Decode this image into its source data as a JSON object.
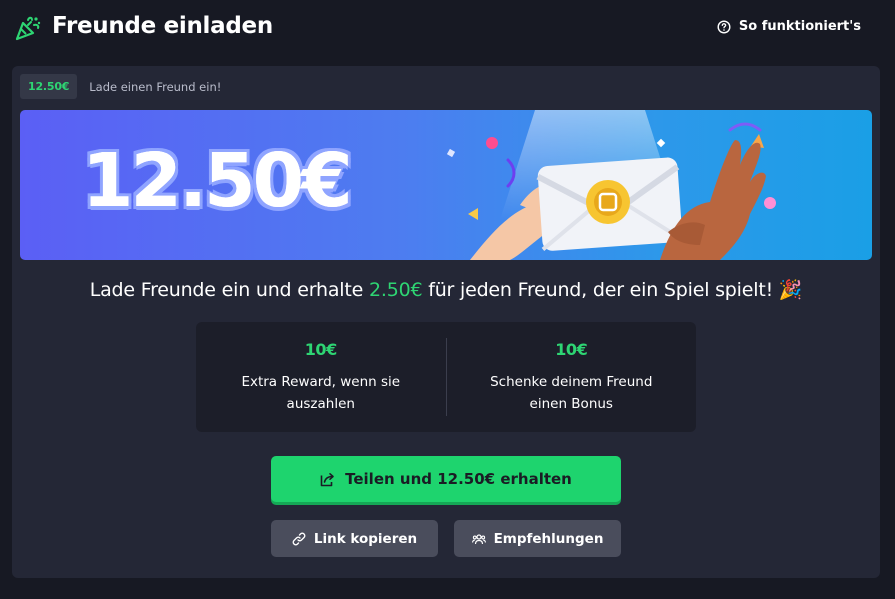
{
  "header": {
    "title": "Freunde einladen",
    "help_link": "So funktioniert's",
    "icons": [
      "party-popper-icon",
      "question-circle-icon"
    ]
  },
  "card": {
    "badge_amount": "12.50€",
    "badge_text": "Lade einen Freund ein!",
    "banner_amount": "12.50€",
    "headline_prefix": "Lade Freunde ein und erhalte ",
    "headline_amount": "2.50€",
    "headline_suffix": " für jeden Freund, der ein Spiel spielt! 🎉",
    "rewards": [
      {
        "value": "10€",
        "desc": "Extra Reward, wenn sie auszahlen"
      },
      {
        "value": "10€",
        "desc": "Schenke deinem Freund einen Bonus"
      }
    ],
    "share_button": "Teilen und 12.50€ erhalten",
    "copy_button": "Link kopieren",
    "recommend_button": "Empfehlungen"
  },
  "colors": {
    "background": "#171923",
    "card": "#242736",
    "accent_green": "#2ed573",
    "button_green": "#1ed46e",
    "banner_gradient_start": "#5b5ff5",
    "banner_gradient_end": "#1a9fe6"
  }
}
